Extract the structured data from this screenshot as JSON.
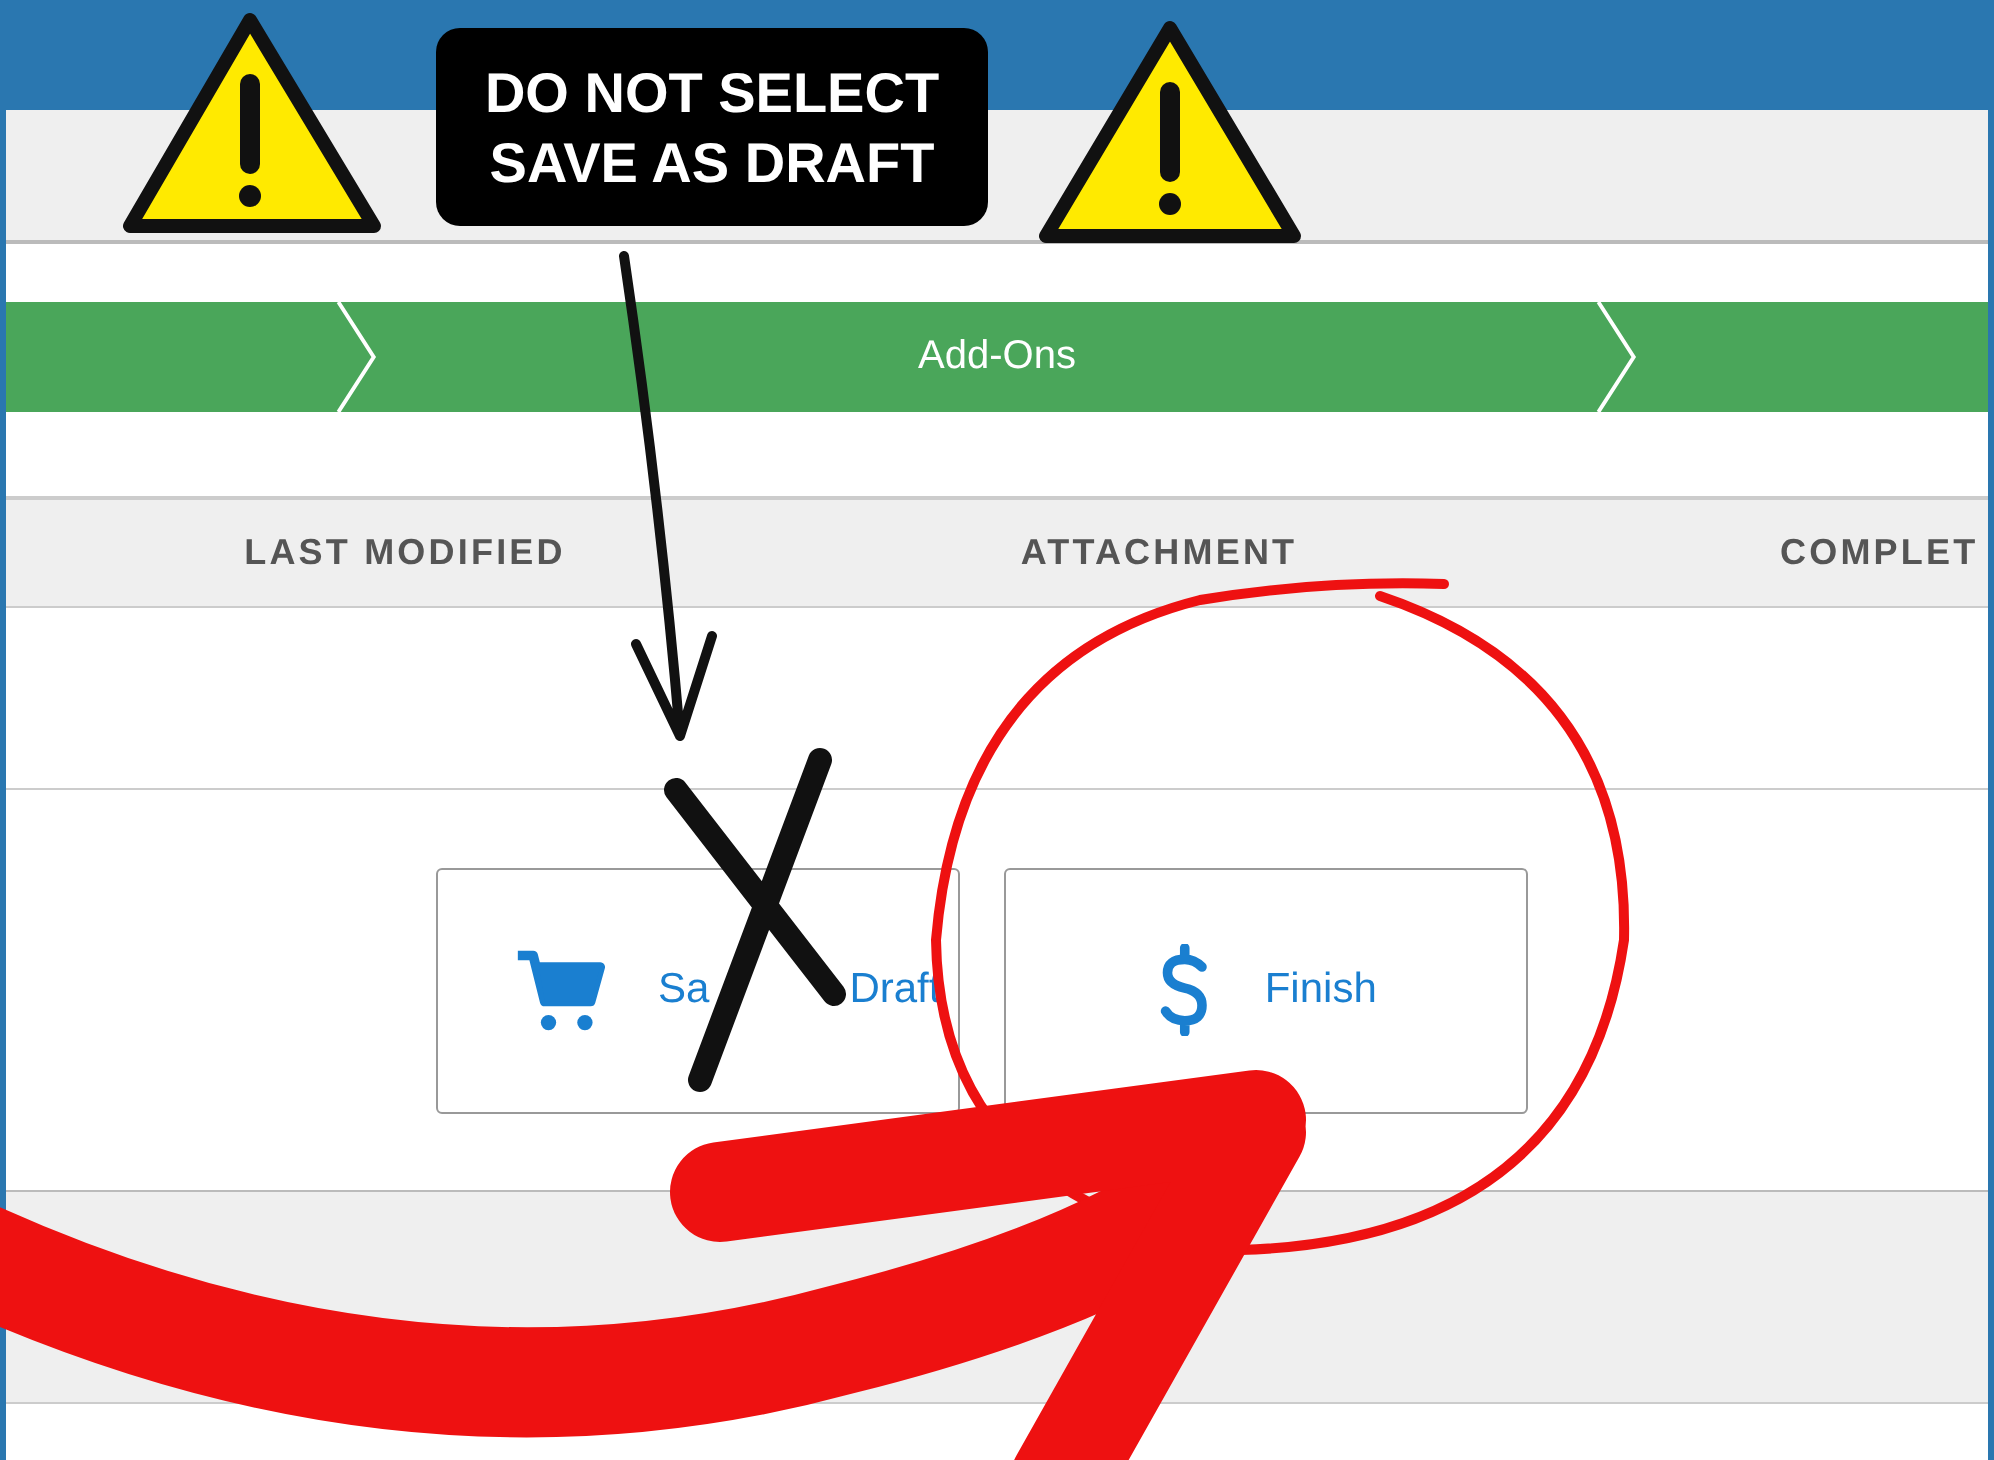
{
  "annotation": {
    "warning": "DO NOT SELECT\nSAVE AS DRAFT"
  },
  "progress": {
    "current_step": "Add-Ons"
  },
  "table": {
    "columns": [
      "LAST MODIFIED",
      "ATTACHMENT",
      "COMPLET"
    ]
  },
  "actions": [
    {
      "label_parts": [
        "Sa",
        "Draft"
      ],
      "kind": "cart"
    },
    {
      "label_parts": [
        "Finish"
      ],
      "kind": "dollar"
    }
  ]
}
